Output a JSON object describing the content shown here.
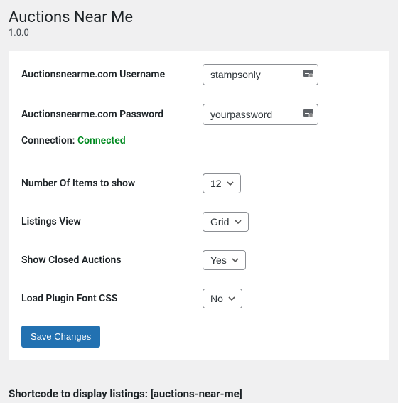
{
  "page": {
    "title": "Auctions Near Me",
    "version": "1.0.0"
  },
  "settings": {
    "username": {
      "label": "Auctionsnearme.com Username",
      "value": "stampsonly"
    },
    "password": {
      "label": "Auctionsnearme.com Password",
      "value": "yourpassword"
    },
    "connection": {
      "label": "Connection: ",
      "status": "Connected"
    },
    "items_to_show": {
      "label": "Number Of Items to show",
      "value": "12"
    },
    "listings_view": {
      "label": "Listings View",
      "value": "Grid"
    },
    "show_closed": {
      "label": "Show Closed Auctions",
      "value": "Yes"
    },
    "load_font_css": {
      "label": "Load Plugin Font CSS",
      "value": "No"
    },
    "save_button": "Save Changes"
  },
  "shortcode": {
    "label": "Shortcode to display listings: ",
    "code": "[auctions-near-me]"
  },
  "icons": {
    "password_manager": "key-lock-icon"
  }
}
